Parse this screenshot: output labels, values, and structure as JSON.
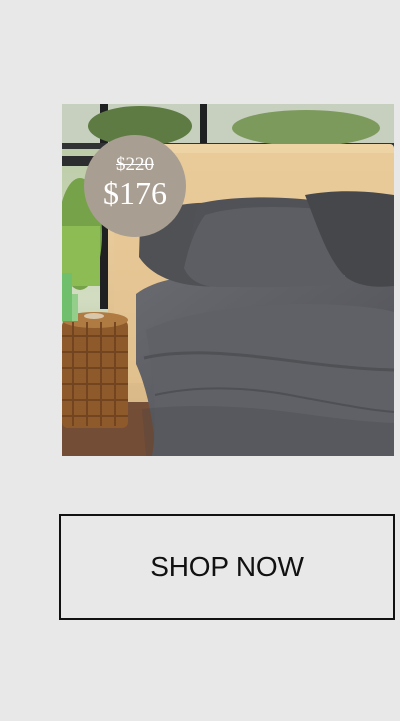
{
  "product": {
    "image_icon": "bed-with-gray-bedding-photo",
    "old_price": "$220",
    "new_price": "$176"
  },
  "cta": {
    "label": "SHOP NOW"
  },
  "colors": {
    "background": "#e8e8e8",
    "badge": "#a99e92",
    "button_border": "#111111",
    "text": "#111111"
  }
}
